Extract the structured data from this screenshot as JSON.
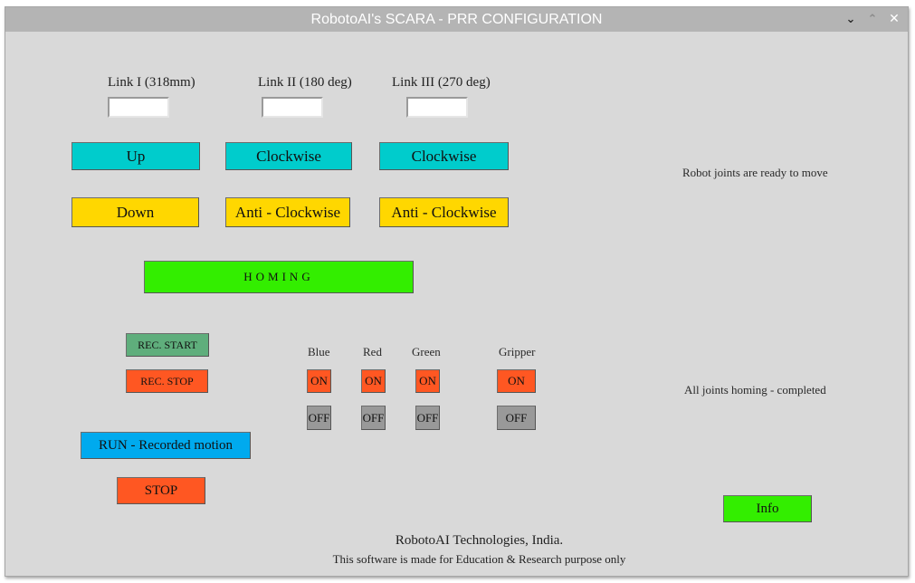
{
  "window": {
    "title": "RobotoAI's SCARA - PRR CONFIGURATION",
    "controls": {
      "minimize": "⌄",
      "maximize": "⌃",
      "close": "✕"
    }
  },
  "links": [
    {
      "label": "Link I (318mm)",
      "value": "",
      "up": "Up",
      "down": "Down"
    },
    {
      "label": "Link II (180 deg)",
      "value": "",
      "up": "Clockwise",
      "down": "Anti - Clockwise"
    },
    {
      "label": "Link III (270 deg)",
      "value": "",
      "up": "Clockwise",
      "down": "Anti - Clockwise"
    }
  ],
  "homing_label": "HOMING",
  "record": {
    "start": "REC. START",
    "stop": "REC. STOP"
  },
  "leds": [
    {
      "label": "Blue",
      "on": "ON",
      "off": "OFF"
    },
    {
      "label": "Red",
      "on": "ON",
      "off": "OFF"
    },
    {
      "label": "Green",
      "on": "ON",
      "off": "OFF"
    },
    {
      "label": "Gripper",
      "on": "ON",
      "off": "OFF"
    }
  ],
  "run_label": "RUN - Recorded motion",
  "stop_label": "STOP",
  "status": {
    "ready": "Robot joints are ready to move",
    "homing": "All joints homing - completed"
  },
  "info_label": "Info",
  "footer": {
    "company": "RobotoAI Technologies, India.",
    "note": "This software is made for Education & Research purpose only"
  },
  "colors": {
    "up": "#00cccc",
    "down": "#ffd700",
    "homing": "#33ee00",
    "rec_start": "#5fae7c",
    "alert": "#ff5722",
    "off": "#999999",
    "run": "#00aaee",
    "info": "#33ee00"
  }
}
